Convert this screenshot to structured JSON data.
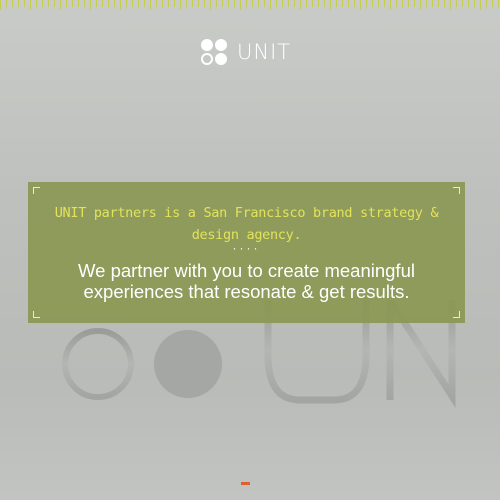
{
  "logo": {
    "text": "UNIT",
    "icon": "four-dots-logo-icon"
  },
  "background": {
    "mark_letters": "UNI",
    "mark_icon": "unit-logo-watermark"
  },
  "hero": {
    "tagline": "UNIT partners is a San Francisco brand strategy & design agency.",
    "separator": "····",
    "statement": "We partner with you to create meaningful experiences that resonate & get results."
  },
  "colors": {
    "panel": "#8b9854",
    "tagline": "#e2e35a",
    "ruler": "#c7cd4e",
    "accent_dash": "#e0612b"
  }
}
